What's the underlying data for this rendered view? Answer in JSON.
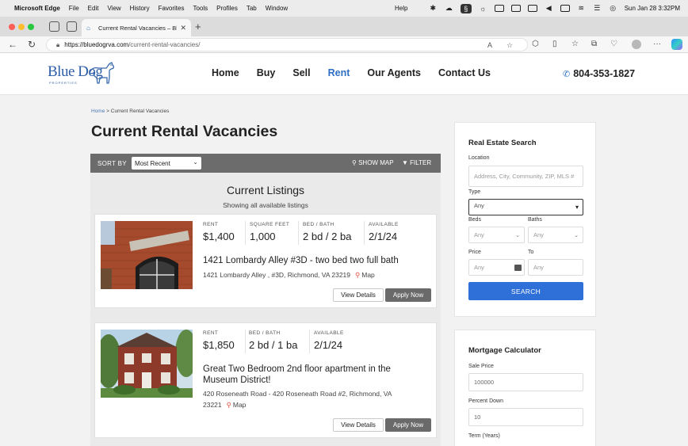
{
  "menubar": {
    "apple": "",
    "items": [
      "Microsoft Edge",
      "File",
      "Edit",
      "View",
      "History",
      "Favorites",
      "Tools",
      "Profiles",
      "Tab",
      "Window"
    ],
    "help": "Help",
    "datetime": "Sun Jan 28  3:32PM"
  },
  "browser": {
    "tab_title": "Current Rental Vacancies – Blu",
    "url_host": "https://bluedogrva.com",
    "url_path": "/current-rental-vacancies/"
  },
  "site": {
    "logo_text": "Blue Dog",
    "logo_sub": "PROPERTIES",
    "nav": [
      "Home",
      "Buy",
      "Sell",
      "Rent",
      "Our Agents",
      "Contact Us"
    ],
    "active_nav": "Rent",
    "phone": "804-353-1827"
  },
  "breadcrumb": {
    "home": "Home",
    "sep": ">",
    "current": "Current Rental Vacancies"
  },
  "page_title": "Current Rental Vacancies",
  "toolbar": {
    "sort_label": "SORT BY",
    "sort_value": "Most Recent",
    "show_map": "SHOW MAP",
    "filter": "FILTER"
  },
  "listings": {
    "heading": "Current Listings",
    "subheading": "Showing all available listings",
    "map_label": "Map",
    "details_label": "View Details",
    "apply_label": "Apply Now",
    "items": [
      {
        "rent_label": "RENT",
        "rent": "$1,400",
        "sqft_label": "SQUARE FEET",
        "sqft": "1,000",
        "bedbath_label": "BED / BATH",
        "bedbath": "2 bd / 2 ba",
        "available_label": "AVAILABLE",
        "available": "2/1/24",
        "title": "1421 Lombardy Alley #3D - two bed two full bath",
        "address": "1421 Lombardy Alley , #3D, Richmond, VA 23219"
      },
      {
        "rent_label": "RENT",
        "rent": "$1,850",
        "bedbath_label": "BED / BATH",
        "bedbath": "2 bd / 1 ba",
        "available_label": "AVAILABLE",
        "available": "2/1/24",
        "title_line1": "Great Two Bedroom 2nd floor apartment in the",
        "title_line2": "Museum District!",
        "address_line1": "420 Roseneath Road - 420 Roseneath Road #2, Richmond, VA",
        "address_line2": "23221"
      }
    ]
  },
  "search": {
    "title": "Real Estate Search",
    "location_label": "Location",
    "location_placeholder": "Address, City, Community, ZIP, MLS #",
    "type_label": "Type",
    "type_value": "Any",
    "beds_label": "Beds",
    "beds_value": "Any",
    "baths_label": "Baths",
    "baths_value": "Any",
    "price_label": "Price",
    "price_from": "Any",
    "to_label": "To",
    "price_to": "Any",
    "button": "SEARCH"
  },
  "mortgage": {
    "title": "Mortgage Calculator",
    "sale_price_label": "Sale Price",
    "sale_price": "100000",
    "percent_down_label": "Percent Down",
    "percent_down": "10",
    "term_label": "Term (Years)"
  },
  "colors": {
    "accent": "#2e6fc4",
    "button_blue": "#2e6fd8",
    "toolbar_gray": "#6c6c6c",
    "pin_red": "#e04a3a"
  }
}
